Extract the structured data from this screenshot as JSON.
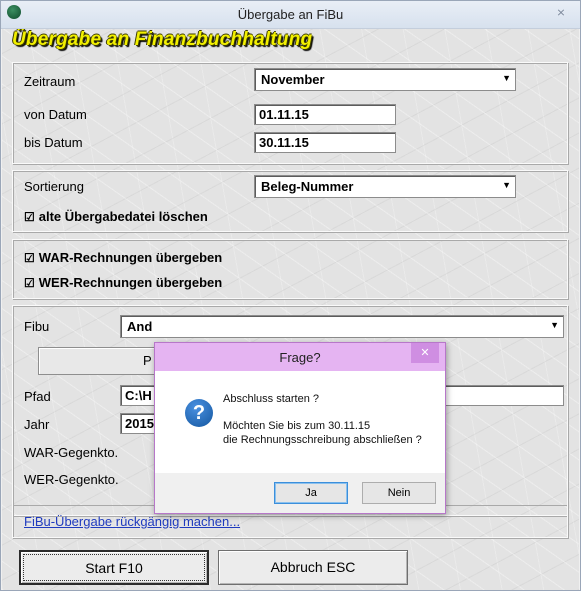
{
  "window": {
    "title": "Übergabe an FiBu",
    "close_glyph": "⨯"
  },
  "heading": "Übergabe an Finanzbuchhaltung",
  "period": {
    "label": "Zeitraum",
    "value": "November",
    "from_label": "von Datum",
    "from_value": "01.11.15",
    "to_label": "bis Datum",
    "to_value": "30.11.15"
  },
  "sorting": {
    "label": "Sortierung",
    "value": "Beleg-Nummer",
    "delete_old_label": "alte Übergabedatei löschen",
    "delete_old_checked": true
  },
  "transfer": {
    "war_label": "WAR-Rechnungen übergeben",
    "war_checked": true,
    "wer_label": "WER-Rechnungen übergeben",
    "wer_checked": true
  },
  "fibu": {
    "label": "Fibu",
    "value": "And",
    "button_label": "P",
    "path_label": "Pfad",
    "path_value": "C:\\H",
    "year_label": "Jahr",
    "year_value": "2015",
    "war_account_label": "WAR-Gegenkto.",
    "wer_account_label": "WER-Gegenkto."
  },
  "undo_link": "FiBu-Übergabe rückgängig machen...",
  "buttons": {
    "start": "Start F10",
    "cancel": "Abbruch ESC"
  },
  "dialog": {
    "title": "Frage?",
    "line1": "Abschluss starten ?",
    "line2": "Möchten Sie bis zum 30.11.15",
    "line3": "die Rechnungsschreibung abschließen ?",
    "yes": "Ja",
    "no": "Nein",
    "icon_glyph": "?",
    "close_glyph": "✕"
  },
  "icons": {
    "checkbox_checked": "☑",
    "dropdown_arrow": "▼"
  },
  "colors": {
    "heading": "#f2f000",
    "dialog_title": "#e5b4f2",
    "link": "#1f3bbf"
  }
}
